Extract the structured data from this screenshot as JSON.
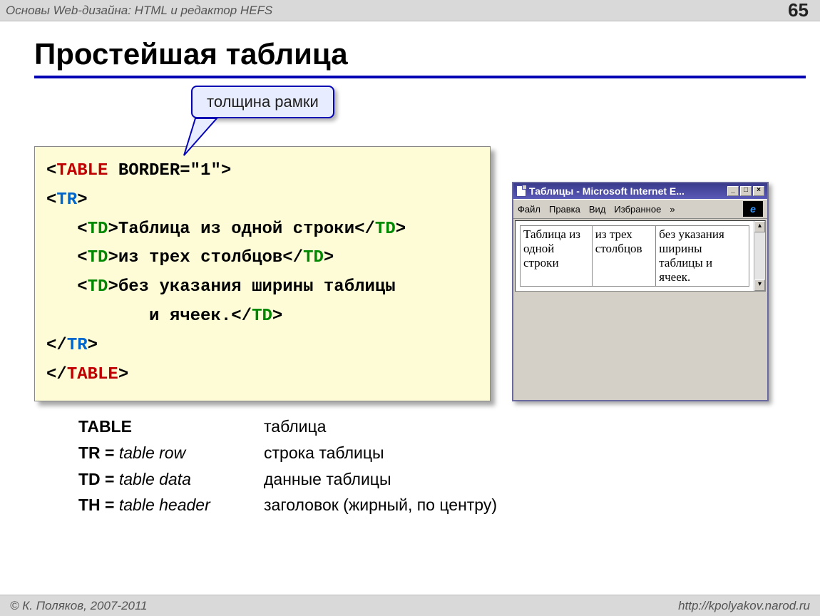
{
  "header": {
    "title": "Основы Web-дизайна: HTML и редактор HEFS",
    "page_num": "65"
  },
  "slide_title": "Простейшая таблица",
  "callout": "толщина рамки",
  "code": {
    "l1_tag": "<TABLE",
    "l1_attr": " BORDER=\"1\">",
    "l2": "<TR>",
    "l3_open": "<TD>",
    "l3_txt": "Таблица из одной строки",
    "l3_close": "</TD>",
    "l4_open": "<TD>",
    "l4_txt": "из трех столбцов",
    "l4_close": "</TD>",
    "l5_open": "<TD>",
    "l5_txt1": "без указания ширины таблицы",
    "l6_txt2": "и ячеек.",
    "l6_close": "</TD>",
    "l7": "</TR>",
    "l8": "</TABLE>"
  },
  "browser": {
    "title": "Таблицы - Microsoft Internet E...",
    "menu": {
      "file": "Файл",
      "edit": "Правка",
      "view": "Вид",
      "fav": "Избранное",
      "more": "»"
    },
    "cells": {
      "c1": "Таблица из одной строки",
      "c2": "из трех столбцов",
      "c3": "без указания ширины таблицы и ячеек."
    }
  },
  "glossary": [
    {
      "term_bold": "TABLE",
      "term_it": "",
      "def": "таблица"
    },
    {
      "term_bold": "TR = ",
      "term_it": "table row",
      "def": "строка таблицы"
    },
    {
      "term_bold": "TD = ",
      "term_it": "table data",
      "def": "данные таблицы"
    },
    {
      "term_bold": "TH = ",
      "term_it": "table header",
      "def": "заголовок (жирный, по центру)"
    }
  ],
  "footer": {
    "left": "© К. Поляков,  2007-2011",
    "right": "http://kpolyakov.narod.ru"
  }
}
